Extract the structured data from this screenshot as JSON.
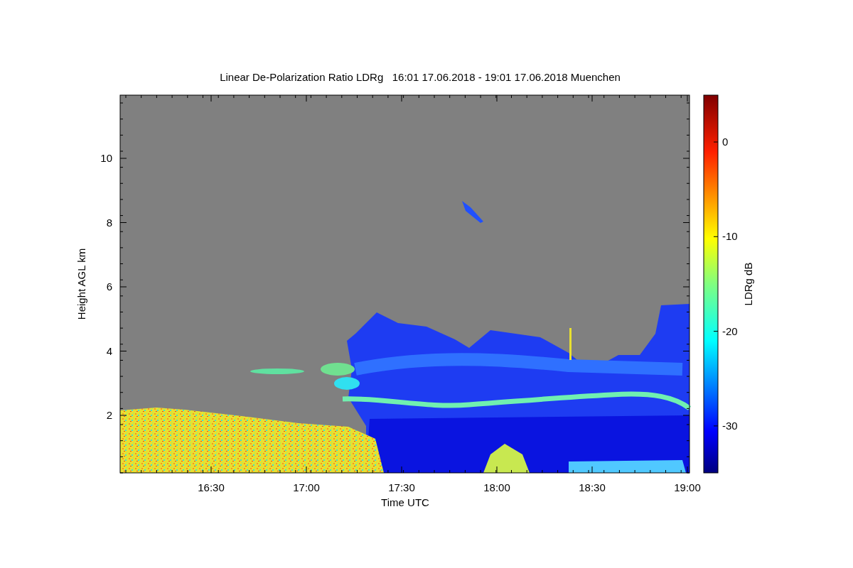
{
  "title": "Linear De-Polarization Ratio LDRg   16:01 17.06.2018 - 19:01 17.06.2018 Muenchen",
  "y_axis": {
    "label": "Height AGL km",
    "ticks": [
      "10",
      "8",
      "6",
      "4",
      "2"
    ]
  },
  "x_axis": {
    "label": "Time UTC",
    "ticks": [
      "16:30",
      "17:00",
      "17:30",
      "18:00",
      "18:30",
      "19:00"
    ]
  },
  "colorbar": {
    "label": "LDRg dB",
    "ticks": [
      "0",
      "-10",
      "-20",
      "-30"
    ]
  }
}
